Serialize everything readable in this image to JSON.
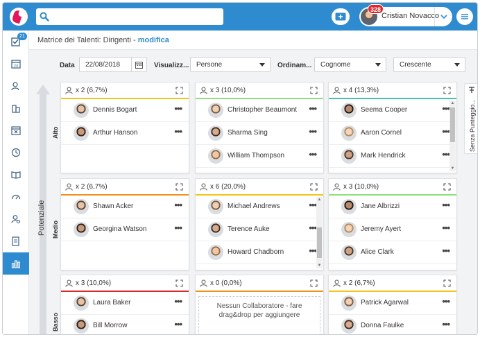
{
  "header": {
    "search_placeholder": "",
    "notifications_count": "328",
    "user_name": "Cristian Novacco"
  },
  "sidebar": {
    "badge": "21",
    "items": [
      {
        "icon": "checklist-icon"
      },
      {
        "icon": "calendar-icon"
      },
      {
        "icon": "users-icon"
      },
      {
        "icon": "buildings-icon"
      },
      {
        "icon": "calendar-x-icon"
      },
      {
        "icon": "clock-icon"
      },
      {
        "icon": "book-icon"
      },
      {
        "icon": "gauge-icon"
      },
      {
        "icon": "user-search-icon"
      },
      {
        "icon": "report-icon"
      },
      {
        "icon": "bar-chart-icon",
        "active": true
      }
    ]
  },
  "breadcrumb": {
    "prefix": "Matrice dei Talenti: Dirigenti - ",
    "link": "modifica"
  },
  "filters": {
    "data_label": "Data",
    "data_value": "22/08/2018",
    "visualizza_label": "Visualizz...",
    "visualizza_value": "Persone",
    "ordinamento_label": "Ordinam...",
    "ordinamento_value": "Cognome",
    "order_value": "Crescente"
  },
  "axis": {
    "y_label": "Potenziale",
    "rows": [
      "Alto",
      "Medio",
      "Basso"
    ]
  },
  "side_tab": {
    "label": "Senza Punteggio..."
  },
  "colors": {
    "primary": "#2f8bd0",
    "badge": "#e0262b",
    "yellow": "#f4c518",
    "green": "#8ee07a",
    "teal": "#3ec6b0",
    "orange": "#f0901e",
    "red": "#d62b2b"
  },
  "panels": [
    {
      "count": "x 2 (6,7%)",
      "color": "#f4c518",
      "members": [
        {
          "name": "Dennis Bogart"
        },
        {
          "name": "Arthur Hanson"
        }
      ]
    },
    {
      "count": "x 3 (10,0%)",
      "color": "#8ee07a",
      "members": [
        {
          "name": "Christopher Beaumont"
        },
        {
          "name": "Sharma Sing"
        },
        {
          "name": "William Thompson"
        }
      ]
    },
    {
      "count": "x 4 (13,3%)",
      "color": "#3ec6b0",
      "members": [
        {
          "name": "Seema Cooper"
        },
        {
          "name": "Aaron Cornel"
        },
        {
          "name": "Mark Hendrick"
        }
      ]
    },
    {
      "count": "x 2 (6,7%)",
      "color": "#f0901e",
      "members": [
        {
          "name": "Shawn Acker"
        },
        {
          "name": "Georgina Watson"
        }
      ]
    },
    {
      "count": "x 6 (20,0%)",
      "color": "#f4c518",
      "members": [
        {
          "name": "Michael Andrews"
        },
        {
          "name": "Terence Auke"
        },
        {
          "name": "Howard Chadborn"
        }
      ]
    },
    {
      "count": "x 3 (10,0%)",
      "color": "#8ee07a",
      "members": [
        {
          "name": "Jane Albrizzi"
        },
        {
          "name": "Jeremy Ayert"
        },
        {
          "name": "Alice Clark"
        }
      ]
    },
    {
      "count": "x 3 (10,0%)",
      "color": "#d62b2b",
      "members": [
        {
          "name": "Laura Baker"
        },
        {
          "name": "Bill Morrow"
        }
      ]
    },
    {
      "count": "x 0 (0,0%)",
      "color": "#f0901e",
      "members": [],
      "empty_text": "Nessun Collaboratore - fare drag&drop per aggiungere"
    },
    {
      "count": "x 2 (6,7%)",
      "color": "#f4c518",
      "members": [
        {
          "name": "Patrick Agarwal"
        },
        {
          "name": "Donna Faulke"
        }
      ]
    }
  ]
}
